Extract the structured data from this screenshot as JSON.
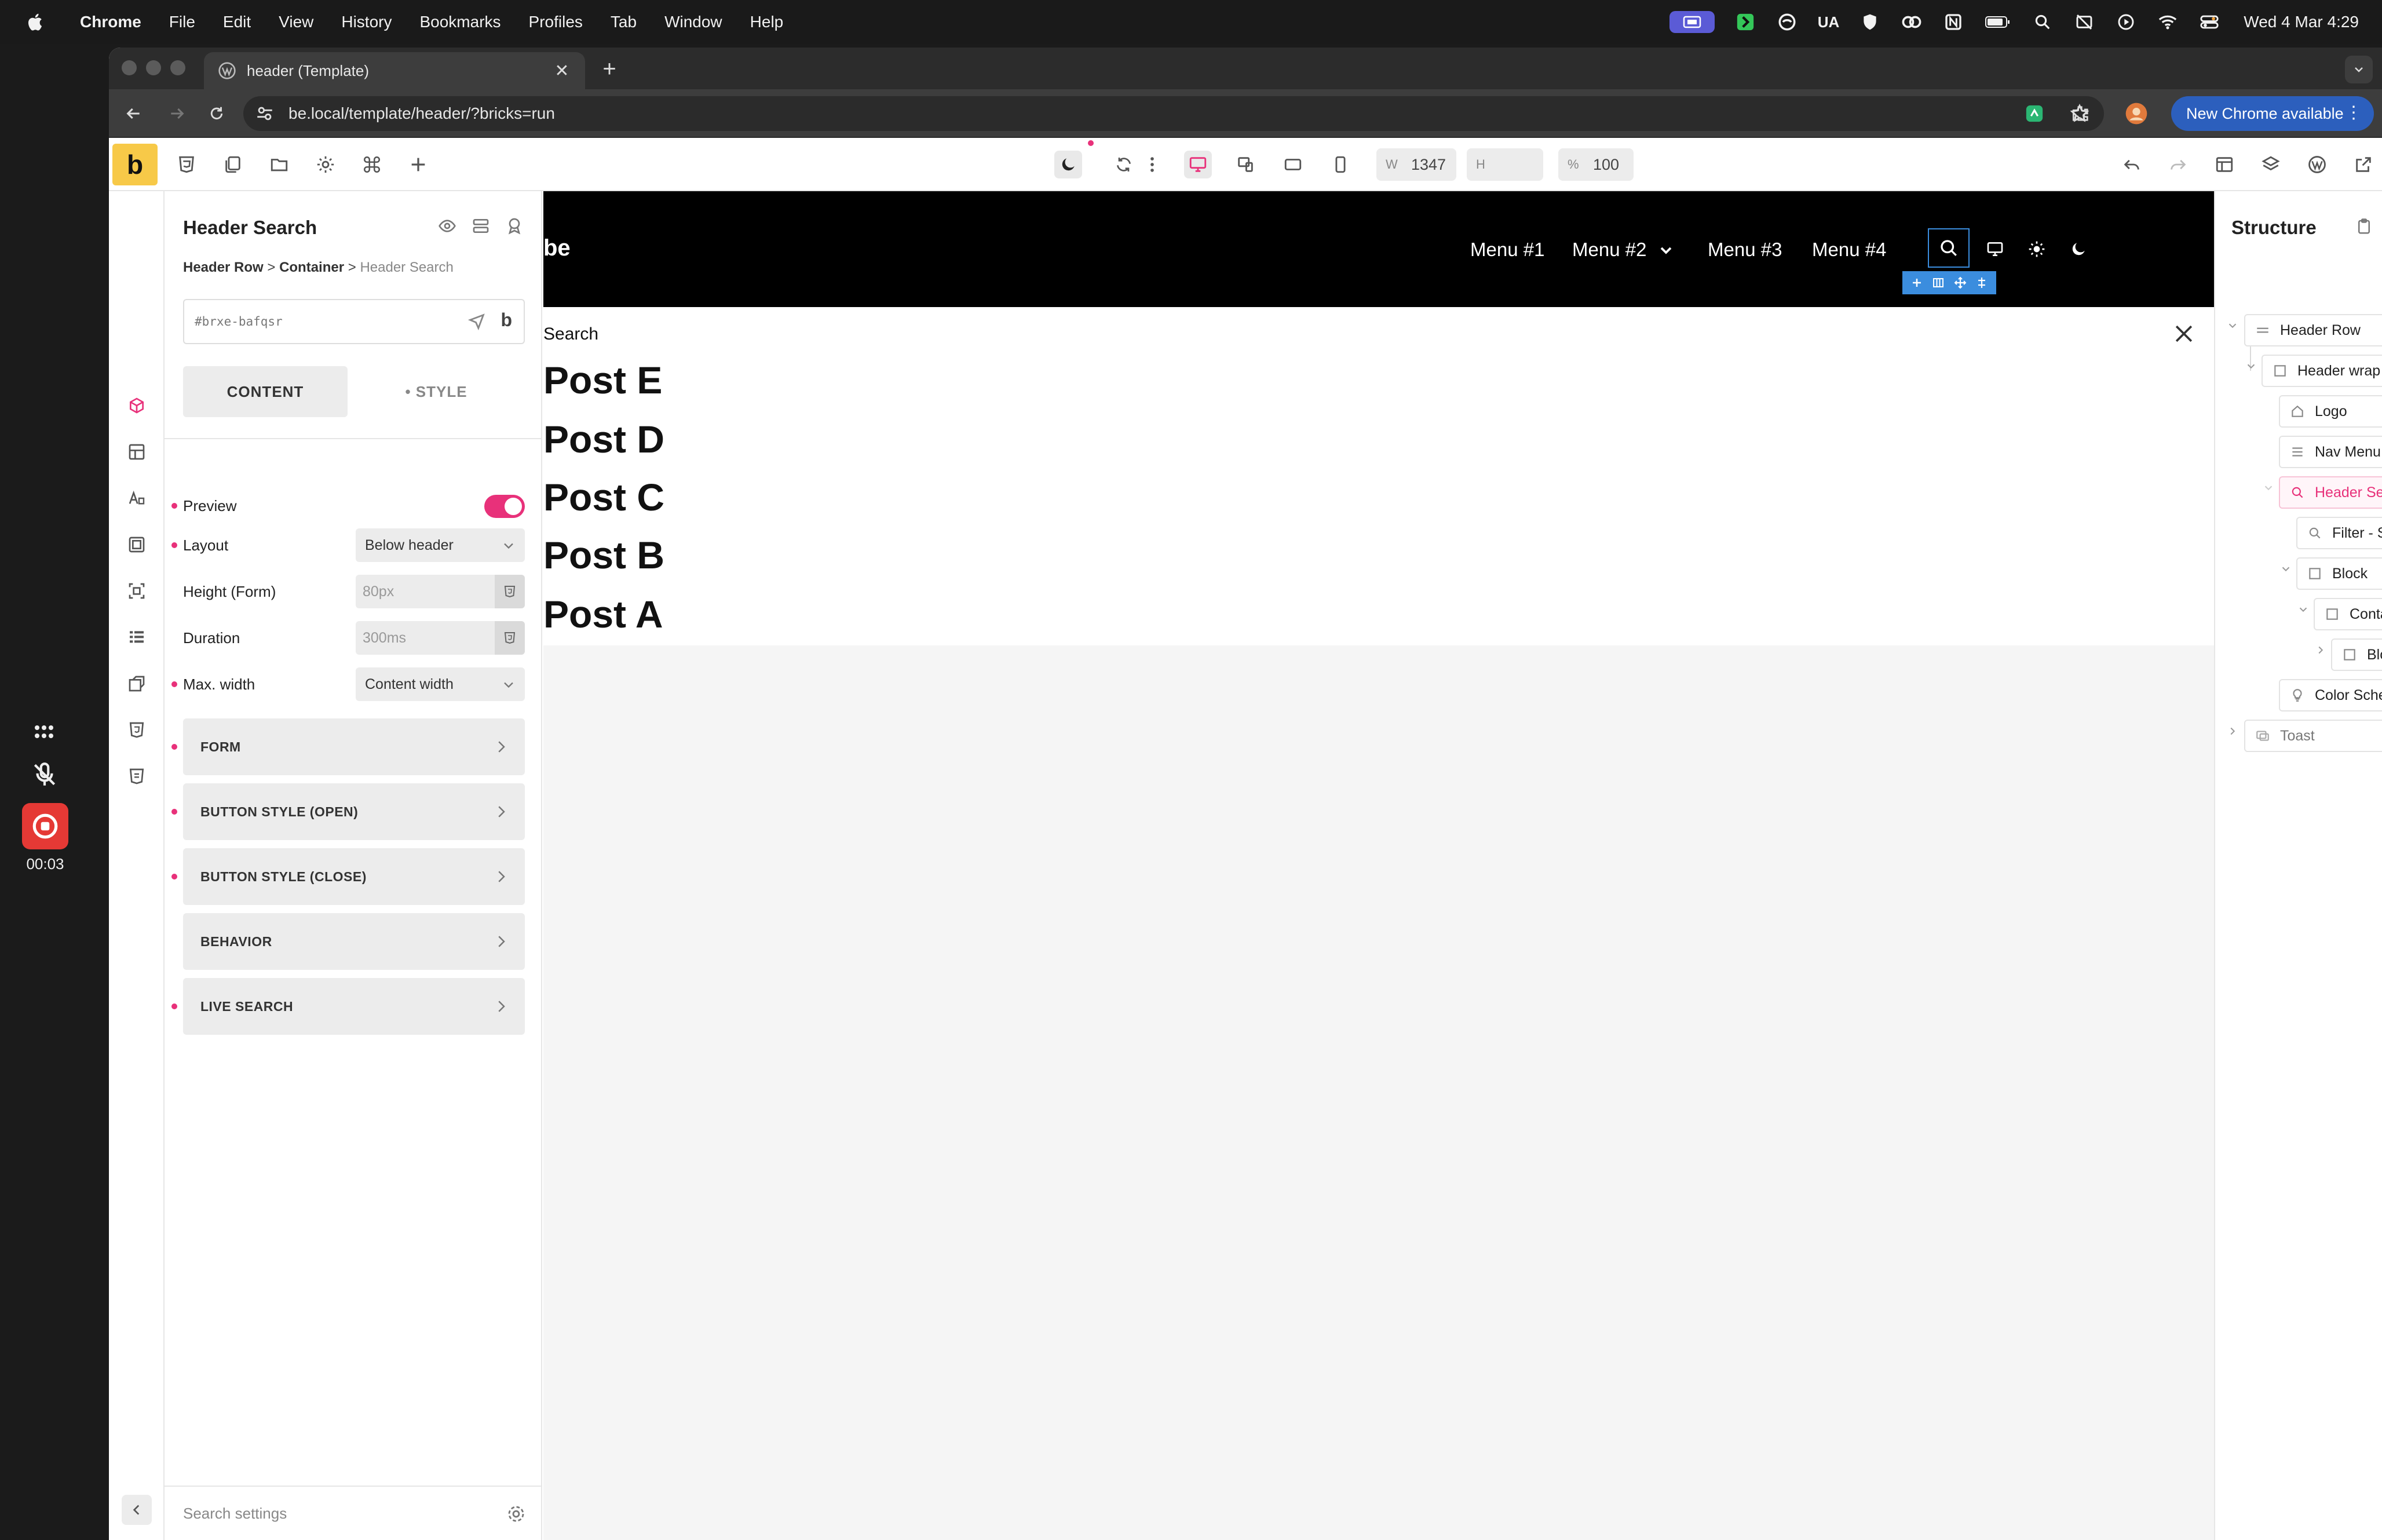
{
  "macos": {
    "menu": [
      "Chrome",
      "File",
      "Edit",
      "View",
      "History",
      "Bookmarks",
      "Profiles",
      "Tab",
      "Window",
      "Help"
    ],
    "status": {
      "ua_label": "UA",
      "clock": "Wed 4 Mar  4:29"
    }
  },
  "recorder": {
    "time": "00:03"
  },
  "browser": {
    "tab_title": "header (Template)",
    "url": "be.local/template/header/?bricks=run",
    "new_chrome_label": "New Chrome available"
  },
  "builder": {
    "logo_letter": "b",
    "width_label": "W",
    "width_value": "1347",
    "height_label": "H",
    "height_value": "",
    "zoom_label": "%",
    "zoom_value": "100"
  },
  "element_panel": {
    "title": "Header Search",
    "breadcrumb": [
      "Header Row",
      "Container",
      "Header Search"
    ],
    "element_id": "#brxe-bafqsr",
    "id_badge": "b",
    "tabs": {
      "content": "CONTENT",
      "style": "• STYLE"
    },
    "preview_label": "Preview",
    "preview_on": true,
    "fields": [
      {
        "label": "Layout",
        "value": "Below header"
      },
      {
        "label": "Height (Form)",
        "placeholder": "80px"
      },
      {
        "label": "Duration",
        "placeholder": "300ms"
      },
      {
        "label": "Max. width",
        "value": "Content width"
      }
    ],
    "sections": [
      "FORM",
      "BUTTON STYLE (OPEN)",
      "BUTTON STYLE (CLOSE)",
      "BEHAVIOR",
      "LIVE SEARCH"
    ],
    "search_placeholder": "Search settings"
  },
  "canvas": {
    "site_logo": "be",
    "menu": [
      "Menu #1",
      "Menu #2",
      "Menu #3",
      "Menu #4"
    ],
    "search_label": "Search",
    "posts": [
      "Post E",
      "Post D",
      "Post C",
      "Post B",
      "Post A"
    ]
  },
  "structure": {
    "title": "Structure",
    "nodes": [
      {
        "label": "Header Row"
      },
      {
        "label": "Header wrap"
      },
      {
        "label": "Logo"
      },
      {
        "label": "Nav Menu"
      },
      {
        "label": "Header Search",
        "selected": true
      },
      {
        "label": "Filter - Search"
      },
      {
        "label": "Block"
      },
      {
        "label": "Container"
      },
      {
        "label": "Block"
      },
      {
        "label": "Color Scheme Toggle"
      },
      {
        "label": "Toast"
      }
    ]
  },
  "colors": {
    "accent": "#e8317a",
    "brand": "#f7c948",
    "selection": "#3b8dde",
    "chrome_button": "#2c5fbd"
  }
}
